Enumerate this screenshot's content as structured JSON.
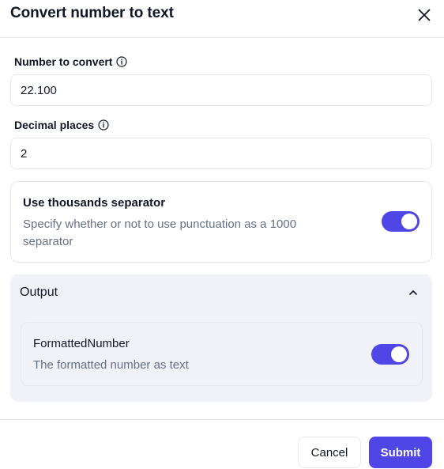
{
  "dialog": {
    "title": "Convert number to text"
  },
  "fields": {
    "number": {
      "label": "Number to convert",
      "value": "22.100"
    },
    "decimals": {
      "label": "Decimal places",
      "value": "2"
    }
  },
  "thousands_separator": {
    "title": "Use thousands separator",
    "description": "Specify whether or not to use punctuation as a 1000 separator",
    "enabled": true
  },
  "output": {
    "title": "Output",
    "expanded": true,
    "variable": {
      "name": "FormattedNumber",
      "description": "The formatted number as text",
      "enabled": true
    }
  },
  "footer": {
    "cancel_label": "Cancel",
    "submit_label": "Submit"
  },
  "colors": {
    "accent": "#4f46e5",
    "border": "#e4e7ec",
    "muted_text": "#667085",
    "section_bg": "#f0f2f7"
  }
}
